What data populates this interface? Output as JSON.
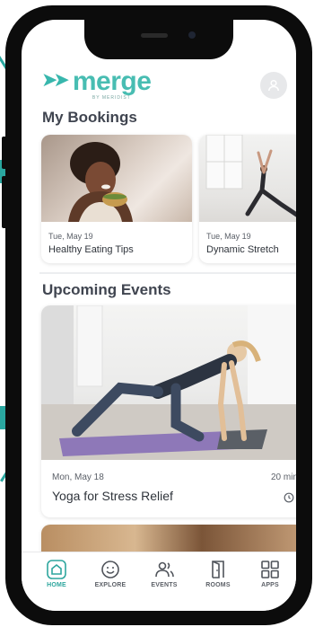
{
  "brand": {
    "logo_text": "merge",
    "logo_subtext": "BY MERIDIST"
  },
  "colors": {
    "accent": "#38b7ad",
    "text": "#2f343b"
  },
  "sections": {
    "bookings_title": "My Bookings",
    "events_title": "Upcoming Events"
  },
  "bookings": [
    {
      "date": "Tue, May 19",
      "title": "Healthy Eating Tips"
    },
    {
      "date": "Tue, May 19",
      "title": "Dynamic Stretch"
    }
  ],
  "events": [
    {
      "date": "Mon, May 18",
      "title": "Yoga for Stress Relief",
      "duration": "20 min"
    }
  ],
  "tabs": [
    {
      "label": "HOME",
      "icon": "home-icon",
      "active": true
    },
    {
      "label": "EXPLORE",
      "icon": "smiley-icon"
    },
    {
      "label": "EVENTS",
      "icon": "people-icon"
    },
    {
      "label": "ROOMS",
      "icon": "door-icon"
    },
    {
      "label": "APPS",
      "icon": "grid-icon"
    }
  ]
}
